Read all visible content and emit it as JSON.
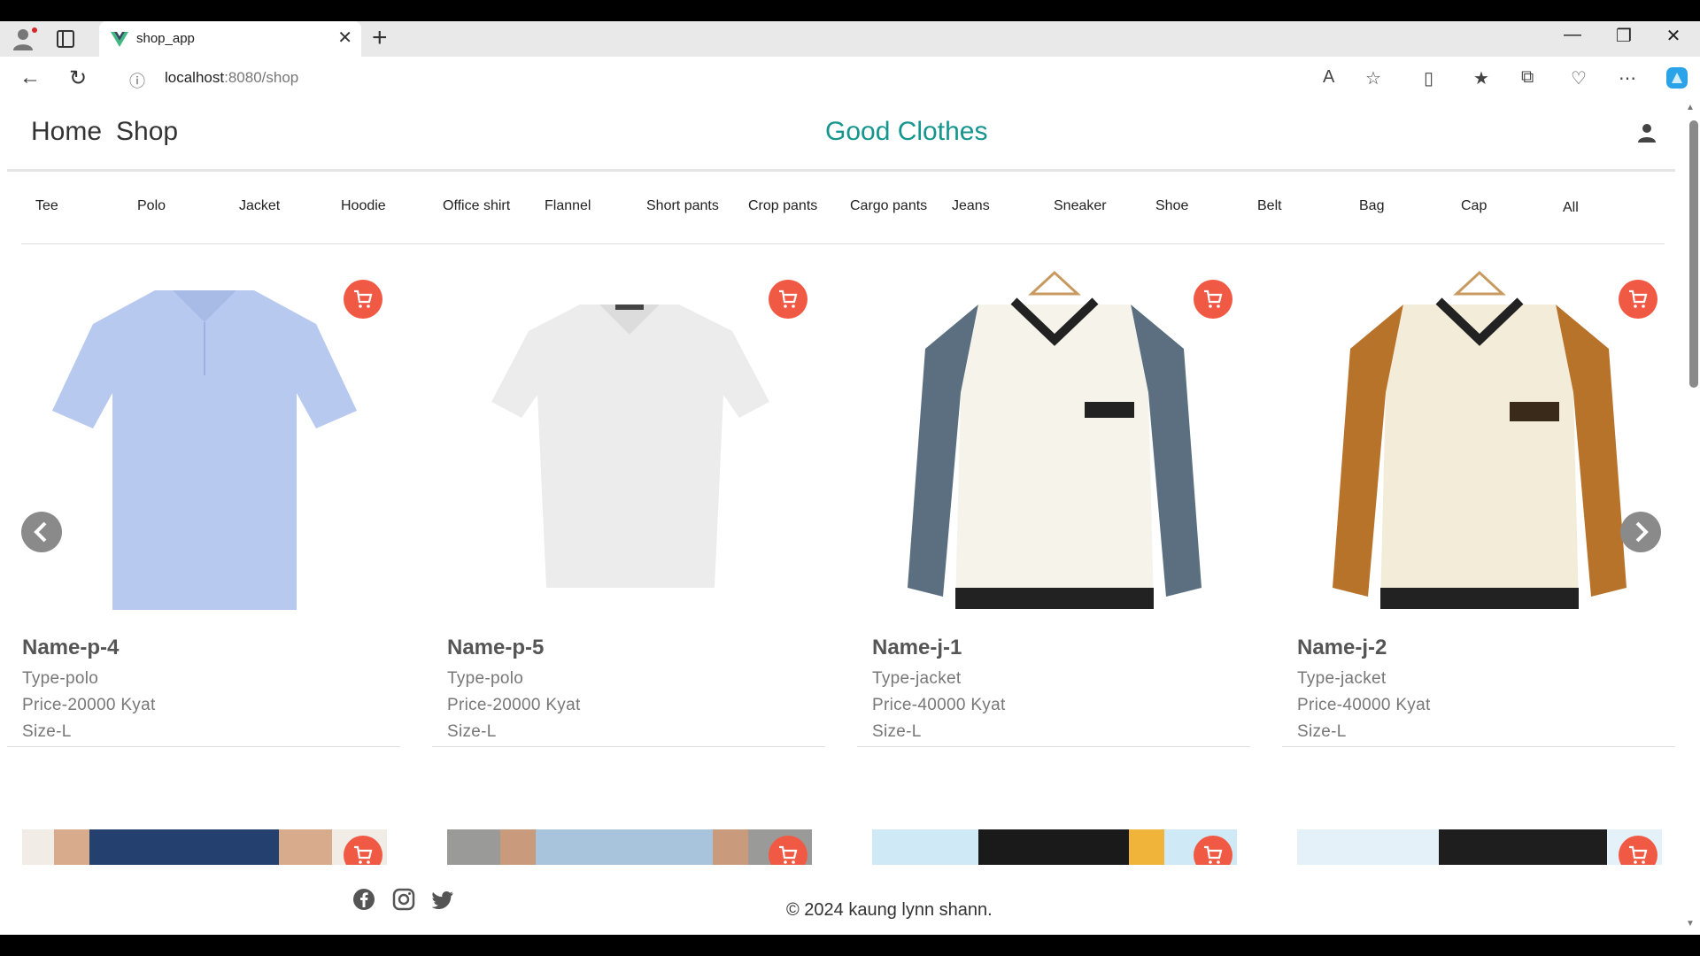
{
  "browser": {
    "tab_title": "shop_app",
    "url_host": "localhost",
    "url_rest": ":8080/shop"
  },
  "header": {
    "nav_home": "Home",
    "nav_shop": "Shop",
    "brand": "Good Clothes"
  },
  "categories": [
    "Tee",
    "Polo",
    "Jacket",
    "Hoodie",
    "Office shirt",
    "Flannel",
    "Short pants",
    "Crop pants",
    "Cargo pants",
    "Jeans",
    "Sneaker",
    "Shoe",
    "Belt",
    "Bag",
    "Cap",
    "All"
  ],
  "products": [
    {
      "name": "Name-p-4",
      "type": "Type-polo",
      "price": "Price-20000 Kyat",
      "size": "Size-L"
    },
    {
      "name": "Name-p-5",
      "type": "Type-polo",
      "price": "Price-20000 Kyat",
      "size": "Size-L"
    },
    {
      "name": "Name-j-1",
      "type": "Type-jacket",
      "price": "Price-40000 Kyat",
      "size": "Size-L"
    },
    {
      "name": "Name-j-2",
      "type": "Type-jacket",
      "price": "Price-40000 Kyat",
      "size": "Size-L"
    }
  ],
  "footer": {
    "copyright": "© 2024 kaung lynn shann."
  },
  "colors": {
    "brand": "#14958e",
    "cart": "#f05a44"
  }
}
